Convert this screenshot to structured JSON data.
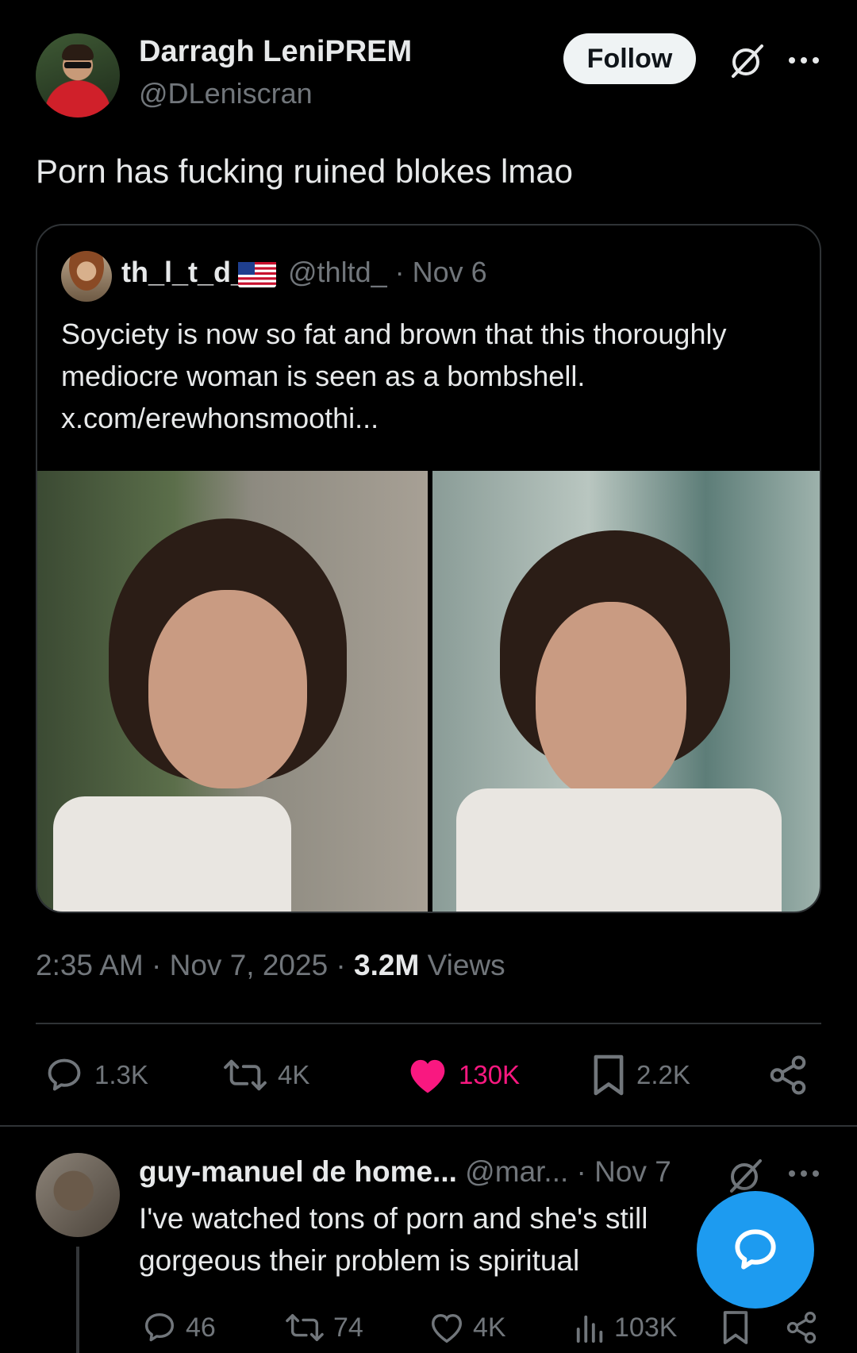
{
  "colors": {
    "background": "#000000",
    "text": "#e7e9ea",
    "muted": "#71767b",
    "like": "#f91880",
    "accent": "#1d9bf0"
  },
  "author": {
    "name": "Darragh LeniPREM",
    "handle": "@DLeniscran"
  },
  "header": {
    "follow_label": "Follow"
  },
  "tweet": {
    "text": "Porn has fucking ruined blokes lmao"
  },
  "quote": {
    "name": "th_l_t_d_",
    "handle_date": "@thltd_ · Nov 6",
    "text": "Soyciety is now so fat and brown that this thoroughly mediocre woman is seen as a bombshell.  x.com/erewhonsmoothi..."
  },
  "meta": {
    "time": "2:35 AM · Nov 7, 2025 · ",
    "views_count": "3.2M",
    "views_label": " Views"
  },
  "actions": {
    "replies": "1.3K",
    "reposts": "4K",
    "likes": "130K",
    "bookmarks": "2.2K"
  },
  "reply": {
    "name": "guy-manuel de home...",
    "handle_date": " @mar... · Nov 7",
    "text": "I've watched tons of porn and she's still gorgeous their problem is spiritual",
    "replies": "46",
    "reposts": "74",
    "likes": "4K",
    "views": "103K"
  },
  "icons": [
    "grok-icon",
    "more-icon",
    "flag-us-icon",
    "reply-icon",
    "repost-icon",
    "heart-icon",
    "bookmark-icon",
    "share-icon",
    "views-icon",
    "compose-reply-icon"
  ]
}
